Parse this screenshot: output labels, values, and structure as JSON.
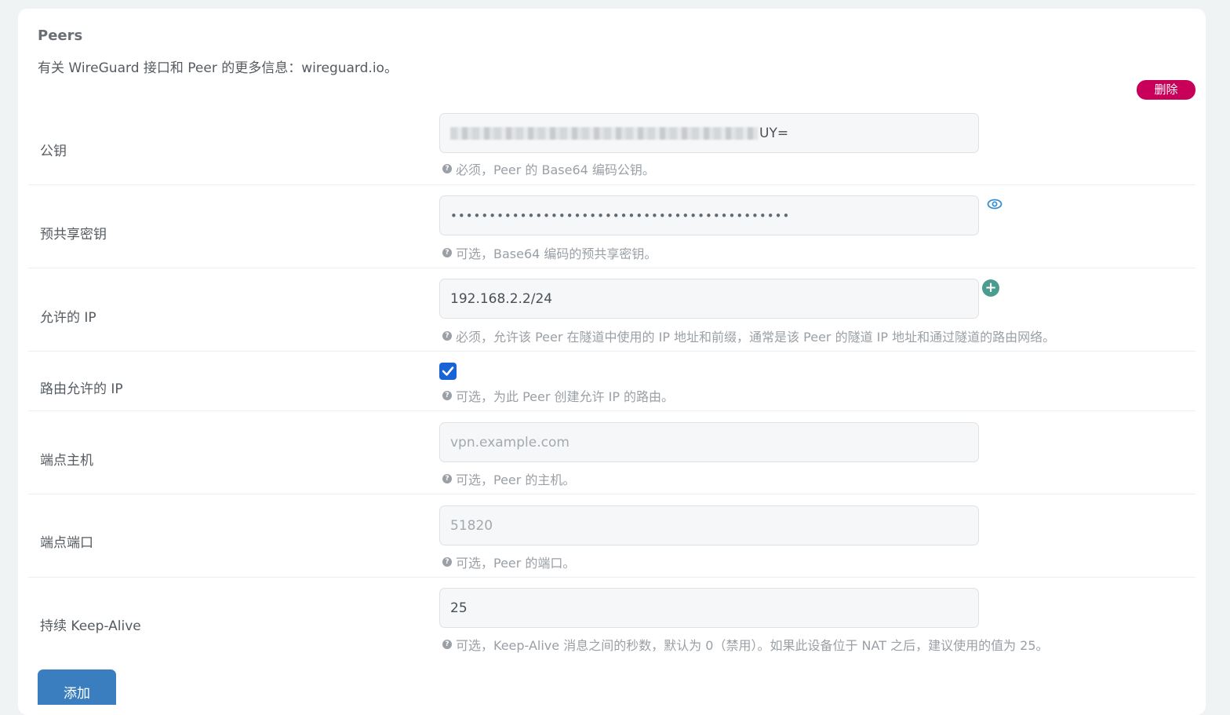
{
  "section": {
    "title": "Peers",
    "description": "有关 WireGuard 接口和 Peer 的更多信息：wireguard.io。",
    "delete_label": "删除",
    "add_label": "添加"
  },
  "fields": {
    "public_key": {
      "label": "公钥",
      "value_visible_suffix": "UY=",
      "help": "必须，Peer 的 Base64 编码公钥。"
    },
    "preshared_key": {
      "label": "预共享密钥",
      "masked_value": "••••••••••••••••••••••••••••••••••••••••••••",
      "help": "可选，Base64 编码的预共享密钥。"
    },
    "allowed_ips": {
      "label": "允许的 IP",
      "value": "192.168.2.2/24",
      "help": "必须，允许该 Peer 在隧道中使用的 IP 地址和前缀，通常是该 Peer 的隧道 IP 地址和通过隧道的路由网络。"
    },
    "route_allowed_ips": {
      "label": "路由允许的 IP",
      "checked": true,
      "help": "可选，为此 Peer 创建允许 IP 的路由。"
    },
    "endpoint_host": {
      "label": "端点主机",
      "placeholder": "vpn.example.com",
      "help": "可选，Peer 的主机。"
    },
    "endpoint_port": {
      "label": "端点端口",
      "placeholder": "51820",
      "help": "可选，Peer 的端口。"
    },
    "keepalive": {
      "label": "持续 Keep-Alive",
      "value": "25",
      "help": "可选，Keep-Alive 消息之间的秒数，默认为 0（禁用）。如果此设备位于 NAT 之后，建议使用的值为 25。"
    }
  },
  "colors": {
    "delete_button": "#c8005a",
    "add_button": "#3a7ebf",
    "checkbox": "#1863d6",
    "add_ip_icon": "#4b9b8f",
    "eye_icon": "#3a8fd0"
  },
  "icons": {
    "help": "question-circle-icon",
    "reveal": "eye-icon",
    "add_ip": "plus-circle-icon",
    "checkbox": "check-icon"
  }
}
